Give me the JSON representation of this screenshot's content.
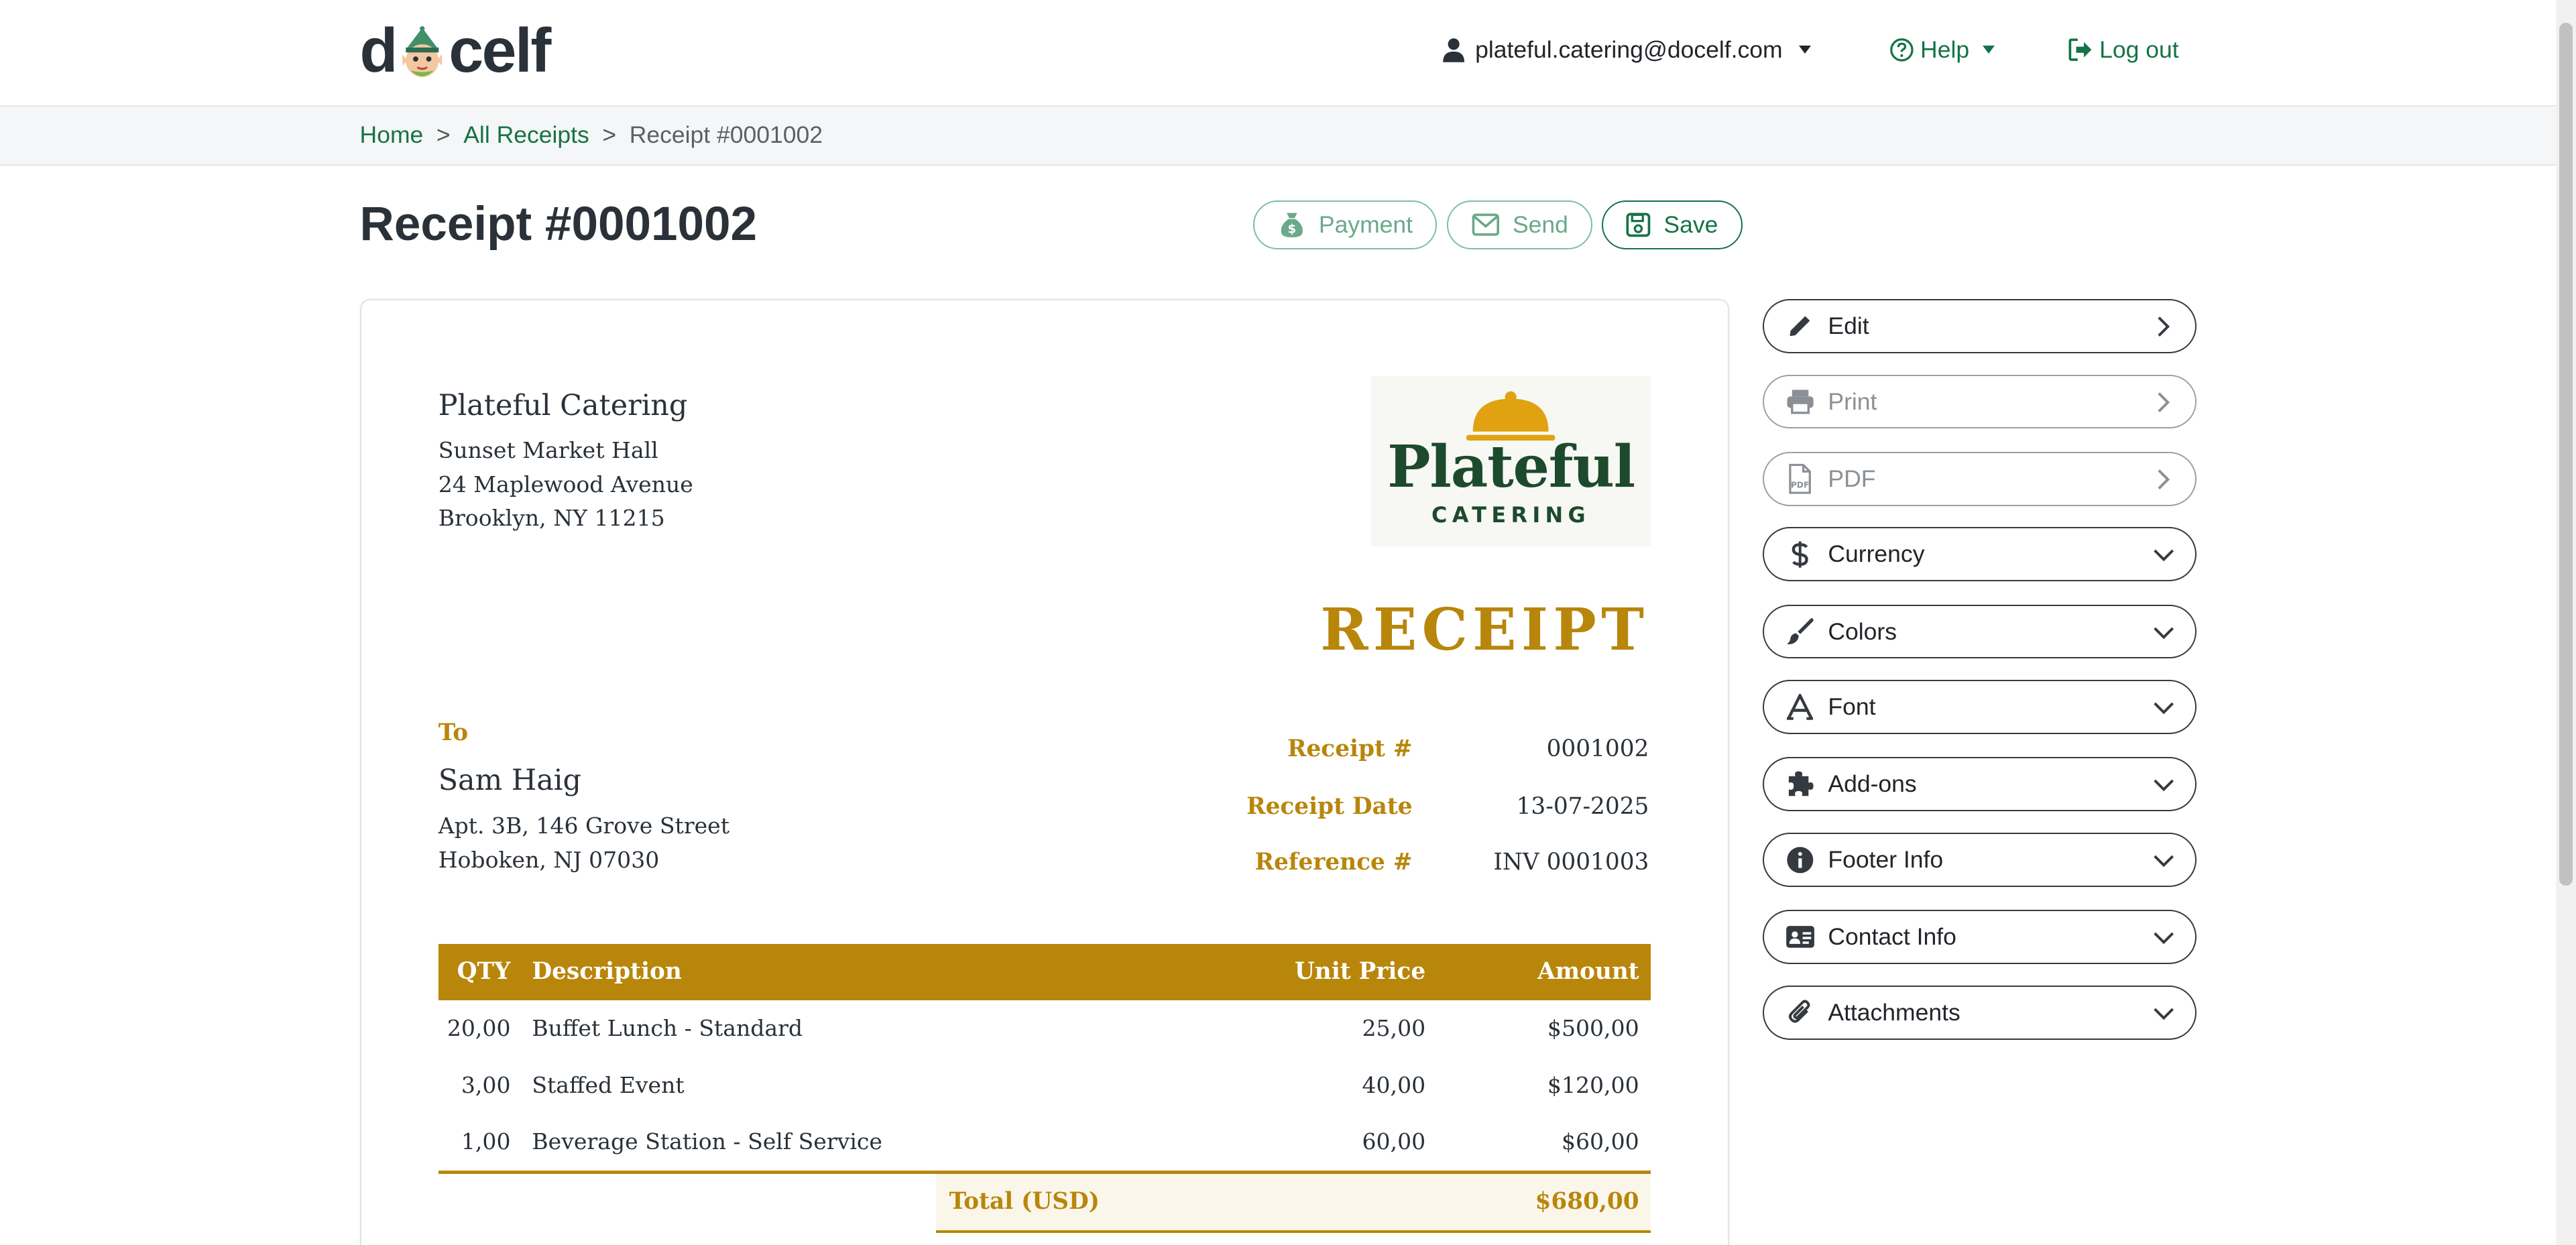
{
  "header": {
    "logo": {
      "left": "d",
      "right": "celf"
    },
    "user_email": "plateful.catering@docelf.com",
    "help_label": "Help",
    "logout_label": "Log out"
  },
  "breadcrumb": {
    "home": "Home",
    "all": "All Receipts",
    "current": "Receipt #0001002"
  },
  "page": {
    "title": "Receipt #0001002"
  },
  "actions": {
    "payment": "Payment",
    "send": "Send",
    "save": "Save"
  },
  "document": {
    "from": {
      "name": "Plateful Catering",
      "lines": [
        "Sunset Market Hall",
        "24 Maplewood Avenue",
        "Brooklyn, NY 11215"
      ]
    },
    "brand": {
      "word": "Plateful",
      "sub": "CATERING"
    },
    "heading": "RECEIPT",
    "to": {
      "label": "To",
      "name": "Sam Haig",
      "lines": [
        "Apt. 3B, 146 Grove Street",
        "Hoboken, NJ 07030"
      ]
    },
    "meta": [
      {
        "label": "Receipt #",
        "value": "0001002"
      },
      {
        "label": "Receipt Date",
        "value": "13-07-2025"
      },
      {
        "label": "Reference #",
        "value": "INV 0001003"
      }
    ],
    "table": {
      "headers": {
        "qty": "QTY",
        "desc": "Description",
        "unit": "Unit Price",
        "amount": "Amount"
      },
      "rows": [
        {
          "qty": "20,00",
          "desc": "Buffet Lunch - Standard",
          "unit": "25,00",
          "amount": "$500,00"
        },
        {
          "qty": "3,00",
          "desc": "Staffed Event",
          "unit": "40,00",
          "amount": "$120,00"
        },
        {
          "qty": "1,00",
          "desc": "Beverage Station - Self Service",
          "unit": "60,00",
          "amount": "$60,00"
        }
      ],
      "total_label": "Total (USD)",
      "total_value": "$680,00"
    }
  },
  "sidebar": [
    {
      "label": "Edit",
      "icon": "pencil-icon",
      "chevron": "right"
    },
    {
      "label": "Print",
      "icon": "printer-icon",
      "chevron": "right"
    },
    {
      "label": "PDF",
      "icon": "pdf-file-icon",
      "chevron": "right"
    },
    {
      "label": "Currency",
      "icon": "dollar-icon",
      "chevron": "down"
    },
    {
      "label": "Colors",
      "icon": "brush-icon",
      "chevron": "down"
    },
    {
      "label": "Font",
      "icon": "font-icon",
      "chevron": "down"
    },
    {
      "label": "Add-ons",
      "icon": "puzzle-icon",
      "chevron": "down"
    },
    {
      "label": "Footer Info",
      "icon": "info-icon",
      "chevron": "down"
    },
    {
      "label": "Contact Info",
      "icon": "contact-card-icon",
      "chevron": "down"
    },
    {
      "label": "Attachments",
      "icon": "paperclip-icon",
      "chevron": "down"
    }
  ],
  "colors": {
    "brand_green": "#157347",
    "accent_gold": "#b8860b",
    "logo_green": "#1d4a2c"
  }
}
